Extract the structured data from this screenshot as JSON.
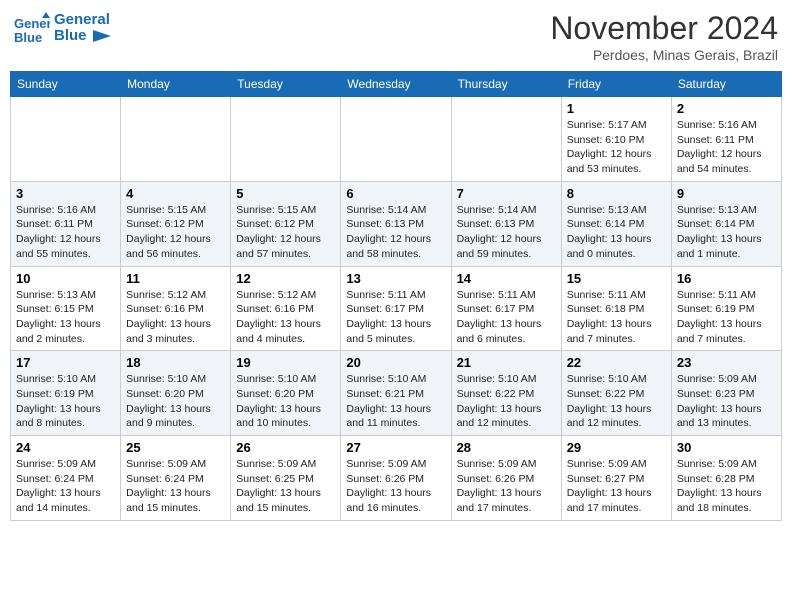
{
  "header": {
    "logo_line1": "General",
    "logo_line2": "Blue",
    "month": "November 2024",
    "location": "Perdoes, Minas Gerais, Brazil"
  },
  "weekdays": [
    "Sunday",
    "Monday",
    "Tuesday",
    "Wednesday",
    "Thursday",
    "Friday",
    "Saturday"
  ],
  "weeks": [
    [
      {
        "day": "",
        "info": ""
      },
      {
        "day": "",
        "info": ""
      },
      {
        "day": "",
        "info": ""
      },
      {
        "day": "",
        "info": ""
      },
      {
        "day": "",
        "info": ""
      },
      {
        "day": "1",
        "info": "Sunrise: 5:17 AM\nSunset: 6:10 PM\nDaylight: 12 hours\nand 53 minutes."
      },
      {
        "day": "2",
        "info": "Sunrise: 5:16 AM\nSunset: 6:11 PM\nDaylight: 12 hours\nand 54 minutes."
      }
    ],
    [
      {
        "day": "3",
        "info": "Sunrise: 5:16 AM\nSunset: 6:11 PM\nDaylight: 12 hours\nand 55 minutes."
      },
      {
        "day": "4",
        "info": "Sunrise: 5:15 AM\nSunset: 6:12 PM\nDaylight: 12 hours\nand 56 minutes."
      },
      {
        "day": "5",
        "info": "Sunrise: 5:15 AM\nSunset: 6:12 PM\nDaylight: 12 hours\nand 57 minutes."
      },
      {
        "day": "6",
        "info": "Sunrise: 5:14 AM\nSunset: 6:13 PM\nDaylight: 12 hours\nand 58 minutes."
      },
      {
        "day": "7",
        "info": "Sunrise: 5:14 AM\nSunset: 6:13 PM\nDaylight: 12 hours\nand 59 minutes."
      },
      {
        "day": "8",
        "info": "Sunrise: 5:13 AM\nSunset: 6:14 PM\nDaylight: 13 hours\nand 0 minutes."
      },
      {
        "day": "9",
        "info": "Sunrise: 5:13 AM\nSunset: 6:14 PM\nDaylight: 13 hours\nand 1 minute."
      }
    ],
    [
      {
        "day": "10",
        "info": "Sunrise: 5:13 AM\nSunset: 6:15 PM\nDaylight: 13 hours\nand 2 minutes."
      },
      {
        "day": "11",
        "info": "Sunrise: 5:12 AM\nSunset: 6:16 PM\nDaylight: 13 hours\nand 3 minutes."
      },
      {
        "day": "12",
        "info": "Sunrise: 5:12 AM\nSunset: 6:16 PM\nDaylight: 13 hours\nand 4 minutes."
      },
      {
        "day": "13",
        "info": "Sunrise: 5:11 AM\nSunset: 6:17 PM\nDaylight: 13 hours\nand 5 minutes."
      },
      {
        "day": "14",
        "info": "Sunrise: 5:11 AM\nSunset: 6:17 PM\nDaylight: 13 hours\nand 6 minutes."
      },
      {
        "day": "15",
        "info": "Sunrise: 5:11 AM\nSunset: 6:18 PM\nDaylight: 13 hours\nand 7 minutes."
      },
      {
        "day": "16",
        "info": "Sunrise: 5:11 AM\nSunset: 6:19 PM\nDaylight: 13 hours\nand 7 minutes."
      }
    ],
    [
      {
        "day": "17",
        "info": "Sunrise: 5:10 AM\nSunset: 6:19 PM\nDaylight: 13 hours\nand 8 minutes."
      },
      {
        "day": "18",
        "info": "Sunrise: 5:10 AM\nSunset: 6:20 PM\nDaylight: 13 hours\nand 9 minutes."
      },
      {
        "day": "19",
        "info": "Sunrise: 5:10 AM\nSunset: 6:20 PM\nDaylight: 13 hours\nand 10 minutes."
      },
      {
        "day": "20",
        "info": "Sunrise: 5:10 AM\nSunset: 6:21 PM\nDaylight: 13 hours\nand 11 minutes."
      },
      {
        "day": "21",
        "info": "Sunrise: 5:10 AM\nSunset: 6:22 PM\nDaylight: 13 hours\nand 12 minutes."
      },
      {
        "day": "22",
        "info": "Sunrise: 5:10 AM\nSunset: 6:22 PM\nDaylight: 13 hours\nand 12 minutes."
      },
      {
        "day": "23",
        "info": "Sunrise: 5:09 AM\nSunset: 6:23 PM\nDaylight: 13 hours\nand 13 minutes."
      }
    ],
    [
      {
        "day": "24",
        "info": "Sunrise: 5:09 AM\nSunset: 6:24 PM\nDaylight: 13 hours\nand 14 minutes."
      },
      {
        "day": "25",
        "info": "Sunrise: 5:09 AM\nSunset: 6:24 PM\nDaylight: 13 hours\nand 15 minutes."
      },
      {
        "day": "26",
        "info": "Sunrise: 5:09 AM\nSunset: 6:25 PM\nDaylight: 13 hours\nand 15 minutes."
      },
      {
        "day": "27",
        "info": "Sunrise: 5:09 AM\nSunset: 6:26 PM\nDaylight: 13 hours\nand 16 minutes."
      },
      {
        "day": "28",
        "info": "Sunrise: 5:09 AM\nSunset: 6:26 PM\nDaylight: 13 hours\nand 17 minutes."
      },
      {
        "day": "29",
        "info": "Sunrise: 5:09 AM\nSunset: 6:27 PM\nDaylight: 13 hours\nand 17 minutes."
      },
      {
        "day": "30",
        "info": "Sunrise: 5:09 AM\nSunset: 6:28 PM\nDaylight: 13 hours\nand 18 minutes."
      }
    ]
  ]
}
